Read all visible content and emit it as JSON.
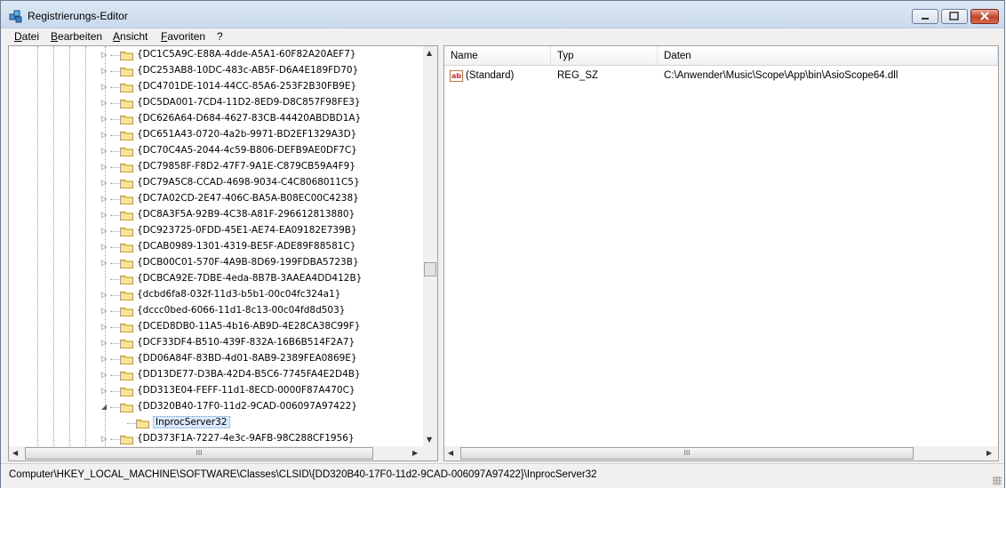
{
  "window": {
    "title": "Registrierungs-Editor",
    "icon": "regedit-icon"
  },
  "menu": [
    "Datei",
    "Bearbeiten",
    "Ansicht",
    "Favoriten",
    "?"
  ],
  "tree": {
    "items": [
      {
        "label": "{DC1C5A9C-E88A-4dde-A5A1-60F82A20AEF7}",
        "expander": "collapsed"
      },
      {
        "label": "{DC253AB8-10DC-483c-AB5F-D6A4E189FD70}",
        "expander": "collapsed"
      },
      {
        "label": "{DC4701DE-1014-44CC-85A6-253F2B30FB9E}",
        "expander": "collapsed"
      },
      {
        "label": "{DC5DA001-7CD4-11D2-8ED9-D8C857F98FE3}",
        "expander": "collapsed"
      },
      {
        "label": "{DC626A64-D684-4627-83CB-44420ABDBD1A}",
        "expander": "collapsed"
      },
      {
        "label": "{DC651A43-0720-4a2b-9971-BD2EF1329A3D}",
        "expander": "collapsed"
      },
      {
        "label": "{DC70C4A5-2044-4c59-B806-DEFB9AE0DF7C}",
        "expander": "collapsed"
      },
      {
        "label": "{DC79858F-F8D2-47F7-9A1E-C879CB59A4F9}",
        "expander": "collapsed"
      },
      {
        "label": "{DC79A5C8-CCAD-4698-9034-C4C8068011C5}",
        "expander": "collapsed"
      },
      {
        "label": "{DC7A02CD-2E47-406C-BA5A-B08EC00C4238}",
        "expander": "collapsed"
      },
      {
        "label": "{DC8A3F5A-92B9-4C38-A81F-296612813880}",
        "expander": "collapsed"
      },
      {
        "label": "{DC923725-0FDD-45E1-AE74-EA09182E739B}",
        "expander": "collapsed"
      },
      {
        "label": "{DCAB0989-1301-4319-BE5F-ADE89F88581C}",
        "expander": "collapsed"
      },
      {
        "label": "{DCB00C01-570F-4A9B-8D69-199FDBA5723B}",
        "expander": "collapsed"
      },
      {
        "label": "{DCBCA92E-7DBE-4eda-8B7B-3AAEA4DD412B}",
        "expander": "none"
      },
      {
        "label": "{dcbd6fa8-032f-11d3-b5b1-00c04fc324a1}",
        "expander": "collapsed"
      },
      {
        "label": "{dccc0bed-6066-11d1-8c13-00c04fd8d503}",
        "expander": "collapsed"
      },
      {
        "label": "{DCED8DB0-11A5-4b16-AB9D-4E28CA38C99F}",
        "expander": "collapsed"
      },
      {
        "label": "{DCF33DF4-B510-439F-832A-16B6B514F2A7}",
        "expander": "collapsed"
      },
      {
        "label": "{DD06A84F-83BD-4d01-8AB9-2389FEA0869E}",
        "expander": "collapsed"
      },
      {
        "label": "{DD13DE77-D3BA-42D4-B5C6-7745FA4E2D4B}",
        "expander": "collapsed"
      },
      {
        "label": "{DD313E04-FEFF-11d1-8ECD-0000F87A470C}",
        "expander": "collapsed"
      },
      {
        "label": "{DD320B40-17F0-11d2-9CAD-006097A97422}",
        "expander": "expanded"
      },
      {
        "label": "InprocServer32",
        "expander": "none",
        "child": true,
        "selected": true
      },
      {
        "label": "{DD373F1A-7227-4e3c-9AFB-98C288CF1956}",
        "expander": "collapsed"
      }
    ]
  },
  "list": {
    "columns": [
      "Name",
      "Typ",
      "Daten"
    ],
    "rows": [
      {
        "name": "(Standard)",
        "type": "REG_SZ",
        "data": "C:\\Anwender\\Music\\Scope\\App\\bin\\AsioScope64.dll",
        "icon": "string-value-icon"
      }
    ]
  },
  "status": {
    "path": "Computer\\HKEY_LOCAL_MACHINE\\SOFTWARE\\Classes\\CLSID\\{DD320B40-17F0-11d2-9CAD-006097A97422}\\InprocServer32"
  },
  "scroll": {
    "grip": "III"
  }
}
